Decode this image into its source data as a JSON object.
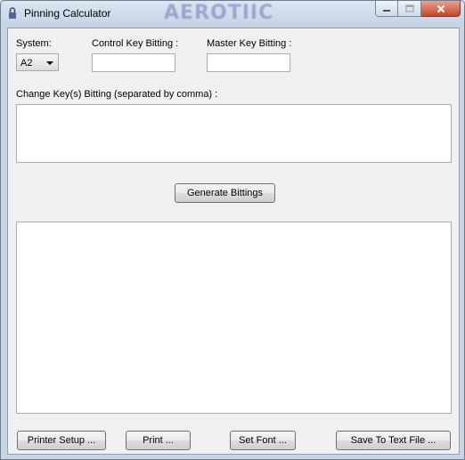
{
  "window": {
    "title": "Pinning Calculator",
    "brand": "AEROTIIC",
    "caption": {
      "minimize_icon": "minimize-icon",
      "maximize_icon": "maximize-icon",
      "close_icon": "close-icon"
    }
  },
  "form": {
    "system_label": "System:",
    "system_value": "A2",
    "control_key_label": "Control Key Bitting :",
    "control_key_value": "",
    "master_key_label": "Master Key Bitting :",
    "master_key_value": "",
    "change_keys_label": "Change Key(s) Bitting (separated by comma) :",
    "change_keys_value": "",
    "generate_label": "Generate Bittings",
    "output_value": ""
  },
  "footer": {
    "printer_setup_label": "Printer Setup ...",
    "print_label": "Print ...",
    "set_font_label": "Set Font ...",
    "save_label": "Save To Text File ..."
  },
  "colors": {
    "close_button": "#c4452c",
    "titlebar": "#c9d4e2"
  }
}
